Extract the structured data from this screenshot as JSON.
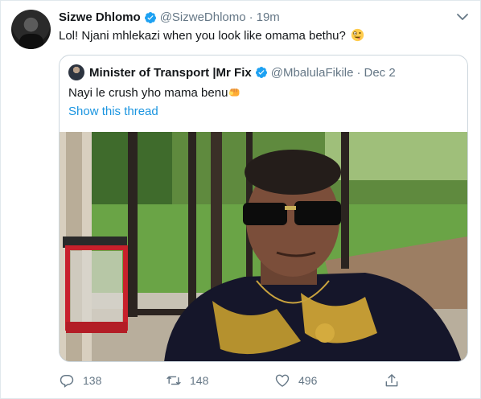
{
  "tweet": {
    "author_name": "Sizwe Dhlomo",
    "handle": "@SizweDhlomo",
    "separator": "·",
    "time": "19m",
    "text": "Lol! Njani mhlekazi when you look like omama bethu?",
    "text_emoji": "zany-face-emoji"
  },
  "quoted": {
    "author_name": "Minister of Transport |Mr Fix",
    "handle": "@MbalulaFikile",
    "separator": "·",
    "date": "Dec 2",
    "text": "Nayi le crush yho mama benu",
    "text_emoji": "fist-emoji",
    "show_thread_label": "Show this thread",
    "photo_description_icon": "photo"
  },
  "actions": {
    "reply_count": "138",
    "retweet_count": "148",
    "like_count": "496"
  },
  "colors": {
    "verified_blue": "#1da1f2",
    "link_blue": "#1b95e0",
    "muted_gray": "#657786",
    "border": "#e1e8ed"
  }
}
